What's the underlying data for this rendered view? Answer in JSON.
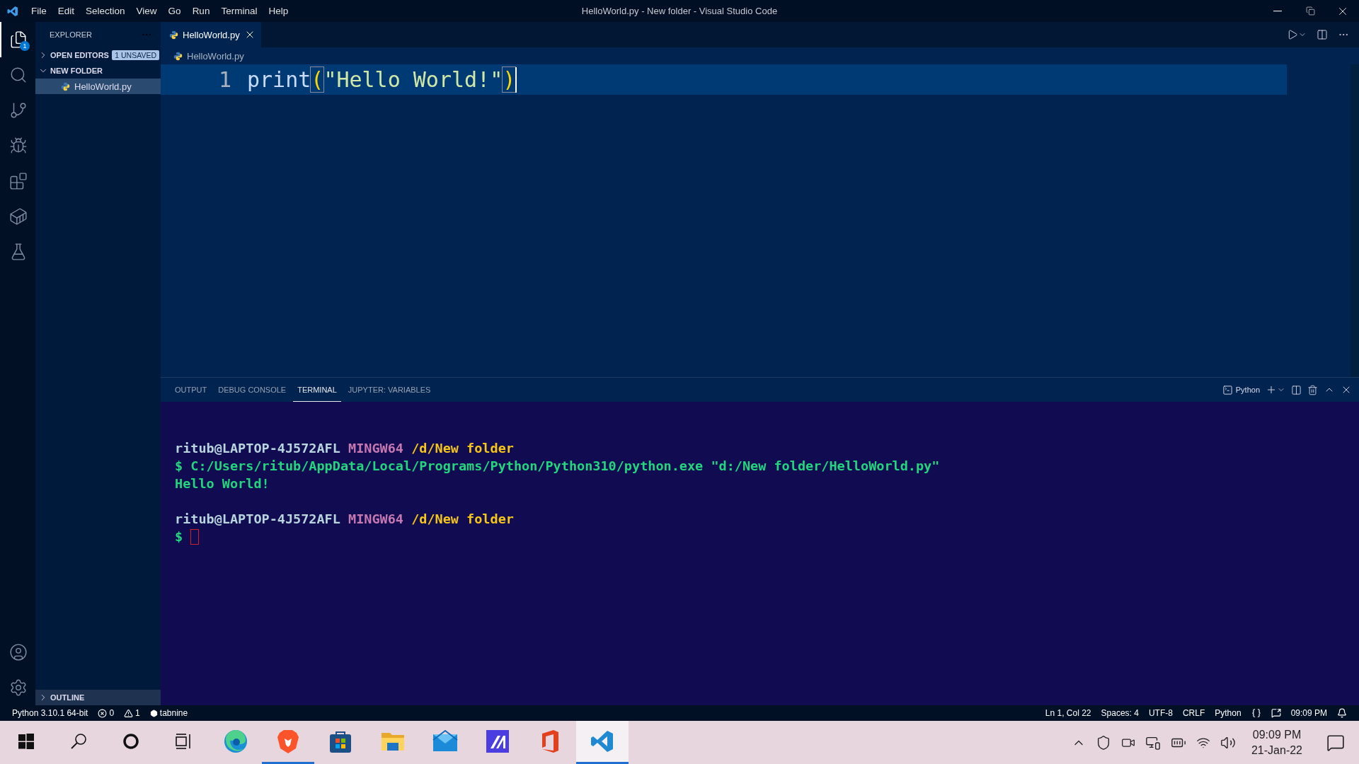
{
  "window": {
    "title": "HelloWorld.py - New folder - Visual Studio Code"
  },
  "menu": [
    "File",
    "Edit",
    "Selection",
    "View",
    "Go",
    "Run",
    "Terminal",
    "Help"
  ],
  "activity_bar": {
    "top": [
      {
        "kind": "files",
        "selected": true,
        "badge": "1"
      },
      {
        "kind": "search",
        "selected": false
      },
      {
        "kind": "git",
        "selected": false
      },
      {
        "kind": "debug",
        "selected": false
      },
      {
        "kind": "extensions",
        "selected": false
      },
      {
        "kind": "docker",
        "selected": false
      },
      {
        "kind": "testing",
        "selected": false
      }
    ],
    "bottom": [
      {
        "kind": "account",
        "selected": false
      },
      {
        "kind": "settings",
        "selected": false
      }
    ]
  },
  "sidebar": {
    "title": "EXPLORER",
    "sections": [
      {
        "label": "OPEN EDITORS",
        "expanded": false,
        "badge": "1 UNSAVED"
      },
      {
        "label": "NEW FOLDER",
        "expanded": true,
        "children": [
          {
            "label": "HelloWorld.py",
            "selected": true
          }
        ]
      }
    ],
    "outline": {
      "label": "OUTLINE",
      "expanded": false
    }
  },
  "tabs": [
    {
      "label": "HelloWorld.py",
      "selected": true
    }
  ],
  "breadcrumb": [
    "HelloWorld.py"
  ],
  "editor": {
    "lines": [
      {
        "number": "1",
        "tokens": [
          {
            "kind": "function",
            "text": "print"
          },
          {
            "kind": "bracket",
            "text": "(",
            "matched": true
          },
          {
            "kind": "string",
            "text": "\"Hello World!\""
          },
          {
            "kind": "bracket",
            "text": ")",
            "matched": true
          }
        ]
      }
    ]
  },
  "panel": {
    "tabs": [
      {
        "label": "OUTPUT",
        "selected": false
      },
      {
        "label": "DEBUG CONSOLE",
        "selected": false
      },
      {
        "label": "TERMINAL",
        "selected": true
      },
      {
        "label": "JUPYTER: VARIABLES",
        "selected": false
      }
    ],
    "shell": "Python",
    "terminal": [
      {
        "kind": "blank"
      },
      {
        "segments": [
          {
            "kind": "user",
            "text": "ritub@LAPTOP-4J572AFL"
          },
          {
            "kind": "env",
            "text": "MINGW64"
          },
          {
            "kind": "path",
            "text": "/d/New folder"
          }
        ]
      },
      {
        "segments": [
          {
            "kind": "output",
            "text": "$ C:/Users/ritub/AppData/Local/Programs/Python/Python310/python.exe \"d:/New folder/HelloWorld.py\""
          }
        ]
      },
      {
        "segments": [
          {
            "kind": "output",
            "text": "Hello World!"
          }
        ]
      },
      {
        "kind": "blank"
      },
      {
        "segments": [
          {
            "kind": "user",
            "text": "ritub@LAPTOP-4J572AFL"
          },
          {
            "kind": "env",
            "text": "MINGW64"
          },
          {
            "kind": "path",
            "text": "/d/New folder"
          }
        ]
      },
      {
        "segments": [
          {
            "kind": "output",
            "text": "$"
          }
        ],
        "cursor": true
      }
    ]
  },
  "status_bar": {
    "left": [
      {
        "kind": "text",
        "label": "Python 3.10.1 64-bit"
      },
      {
        "kind": "errors",
        "label": "0"
      },
      {
        "kind": "warnings",
        "label": "1"
      },
      {
        "kind": "tabnine",
        "label": "tabnine"
      }
    ],
    "right": [
      {
        "kind": "text",
        "label": "Ln 1, Col 22"
      },
      {
        "kind": "text",
        "label": "Spaces: 4"
      },
      {
        "kind": "text",
        "label": "UTF-8"
      },
      {
        "kind": "text",
        "label": "CRLF"
      },
      {
        "kind": "text",
        "label": "Python"
      },
      {
        "kind": "braces"
      },
      {
        "kind": "feedback"
      },
      {
        "kind": "text",
        "label": "09:09 PM"
      },
      {
        "kind": "bell"
      }
    ]
  },
  "taskbar": {
    "apps": [
      {
        "kind": "start",
        "running": false,
        "selected": false
      },
      {
        "kind": "search",
        "running": false,
        "selected": false
      },
      {
        "kind": "cortana",
        "running": false,
        "selected": false
      },
      {
        "kind": "taskview",
        "running": false,
        "selected": false
      },
      {
        "kind": "edge",
        "running": false,
        "selected": false
      },
      {
        "kind": "brave",
        "running": true,
        "selected": false
      },
      {
        "kind": "store",
        "running": false,
        "selected": false
      },
      {
        "kind": "folder",
        "running": false,
        "selected": false
      },
      {
        "kind": "mail",
        "running": false,
        "selected": false
      },
      {
        "kind": "editor",
        "running": false,
        "selected": false
      },
      {
        "kind": "office",
        "running": false,
        "selected": false
      },
      {
        "kind": "vscode",
        "running": true,
        "selected": true
      }
    ],
    "time": "09:09 PM",
    "date": "21-Jan-22"
  }
}
